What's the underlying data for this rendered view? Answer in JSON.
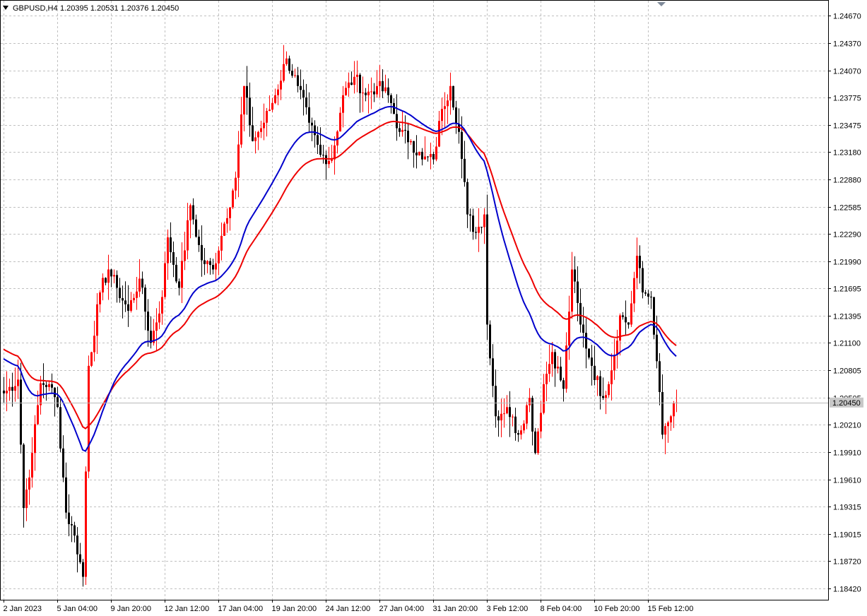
{
  "header": {
    "symbol_tf": "GBPUSD,H4",
    "ohlc": "1.20395 1.20531 1.20376 1.20450"
  },
  "colors": {
    "bull": "#ff0000",
    "bear": "#000000",
    "ma_fast": "#0000cc",
    "ma_slow": "#ee0000",
    "grid": "#c0c0c0",
    "price_tag_bg": "#c8c8c8"
  },
  "chart_data": {
    "type": "candlestick",
    "symbol": "GBPUSD",
    "timeframe": "H4",
    "current_price": "1.20450",
    "ylim": [
      1.183,
      1.2483
    ],
    "grid": true,
    "price_ticks": [
      "1.24670",
      "1.24370",
      "1.24070",
      "1.23775",
      "1.23475",
      "1.23180",
      "1.22880",
      "1.22585",
      "1.22290",
      "1.21990",
      "1.21695",
      "1.21395",
      "1.21100",
      "1.20805",
      "1.20505",
      "1.20210",
      "1.19910",
      "1.19610",
      "1.19315",
      "1.19015",
      "1.18720",
      "1.18420"
    ],
    "time_ticks": [
      {
        "bar": 0,
        "label": "2 Jan 2023"
      },
      {
        "bar": 19,
        "label": "5 Jan 04:00"
      },
      {
        "bar": 38,
        "label": "9 Jan 20:00"
      },
      {
        "bar": 57,
        "label": "12 Jan 12:00"
      },
      {
        "bar": 76,
        "label": "17 Jan 04:00"
      },
      {
        "bar": 95,
        "label": "19 Jan 20:00"
      },
      {
        "bar": 114,
        "label": "24 Jan 12:00"
      },
      {
        "bar": 133,
        "label": "27 Jan 04:00"
      },
      {
        "bar": 152,
        "label": "31 Jan 20:00"
      },
      {
        "bar": 171,
        "label": "3 Feb 12:00"
      },
      {
        "bar": 190,
        "label": "8 Feb 04:00"
      },
      {
        "bar": 209,
        "label": "10 Feb 20:00"
      },
      {
        "bar": 228,
        "label": "15 Feb 12:00"
      }
    ],
    "key_closes": [
      [
        0,
        1.2055
      ],
      [
        5,
        1.207
      ],
      [
        7,
        1.193
      ],
      [
        10,
        1.199
      ],
      [
        13,
        1.2066
      ],
      [
        16,
        1.2065
      ],
      [
        19,
        1.204
      ],
      [
        22,
        1.1925
      ],
      [
        25,
        1.19
      ],
      [
        28,
        1.1855
      ],
      [
        30,
        1.2085
      ],
      [
        34,
        1.2165
      ],
      [
        37,
        1.219
      ],
      [
        40,
        1.217
      ],
      [
        44,
        1.2145
      ],
      [
        48,
        1.218
      ],
      [
        52,
        1.211
      ],
      [
        56,
        1.216
      ],
      [
        58,
        1.2225
      ],
      [
        62,
        1.217
      ],
      [
        66,
        1.226
      ],
      [
        70,
        1.22
      ],
      [
        74,
        1.219
      ],
      [
        78,
        1.224
      ],
      [
        82,
        1.229
      ],
      [
        85,
        1.239
      ],
      [
        88,
        1.233
      ],
      [
        92,
        1.235
      ],
      [
        96,
        1.238
      ],
      [
        100,
        1.242
      ],
      [
        104,
        1.239
      ],
      [
        108,
        1.235
      ],
      [
        112,
        1.2315
      ],
      [
        116,
        1.231
      ],
      [
        120,
        1.238
      ],
      [
        124,
        1.24
      ],
      [
        128,
        1.238
      ],
      [
        132,
        1.239
      ],
      [
        136,
        1.238
      ],
      [
        140,
        1.234
      ],
      [
        144,
        1.233
      ],
      [
        148,
        1.231
      ],
      [
        152,
        1.231
      ],
      [
        155,
        1.2365
      ],
      [
        158,
        1.239
      ],
      [
        161,
        1.234
      ],
      [
        164,
        1.225
      ],
      [
        167,
        1.223
      ],
      [
        170,
        1.225
      ],
      [
        171,
        1.213
      ],
      [
        174,
        1.203
      ],
      [
        178,
        1.204
      ],
      [
        182,
        1.201
      ],
      [
        186,
        1.205
      ],
      [
        188,
        1.199
      ],
      [
        191,
        1.2065
      ],
      [
        194,
        1.21
      ],
      [
        198,
        1.206
      ],
      [
        201,
        1.219
      ],
      [
        204,
        1.213
      ],
      [
        208,
        1.2085
      ],
      [
        212,
        1.205
      ],
      [
        215,
        1.208
      ],
      [
        218,
        1.214
      ],
      [
        221,
        1.213
      ],
      [
        224,
        1.2205
      ],
      [
        226,
        1.2165
      ],
      [
        229,
        1.216
      ],
      [
        231,
        1.209
      ],
      [
        233,
        1.201
      ],
      [
        236,
        1.203
      ],
      [
        238,
        1.2045
      ]
    ],
    "series": [
      {
        "name": "",
        "type": "ma",
        "period": 50
      },
      {
        "name": "",
        "type": "ma",
        "period": 34
      }
    ]
  }
}
